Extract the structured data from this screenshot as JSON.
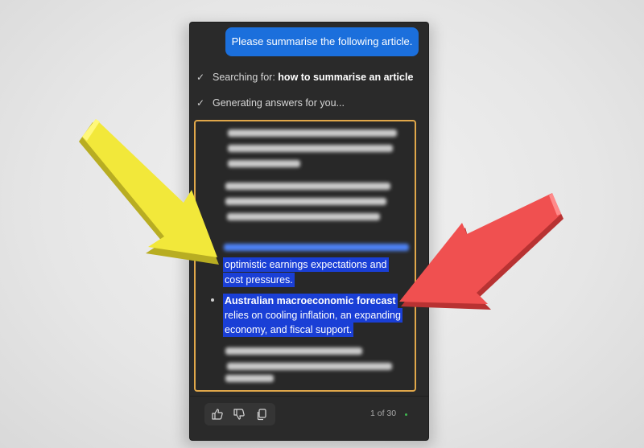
{
  "chat": {
    "user_message": "Please summarise the following article.",
    "steps": [
      {
        "prefix": "Searching for: ",
        "query": "how to summarise an article"
      },
      {
        "prefix": "Generating answers for you...",
        "query": ""
      }
    ]
  },
  "answer": {
    "highlighted_line_1": "optimistic earnings expectations and",
    "highlighted_line_2": "cost pressures.",
    "bullet_title": "Australian macroeconomic forecast",
    "bullet_line_1": "relies on cooling inflation, an expanding",
    "bullet_line_2": "economy, and fiscal support."
  },
  "footer": {
    "page_indicator": "1 of 30"
  },
  "icons": {
    "check": "check-icon",
    "thumbs_up": "thumbs-up-icon",
    "thumbs_down": "thumbs-down-icon",
    "copy": "copy-icon"
  },
  "colors": {
    "user_bubble": "#1b6fdc",
    "highlight": "#1a3fd6",
    "answer_border": "#e0a74a",
    "yellow_arrow": "#f2e83a",
    "red_arrow": "#f05050"
  }
}
